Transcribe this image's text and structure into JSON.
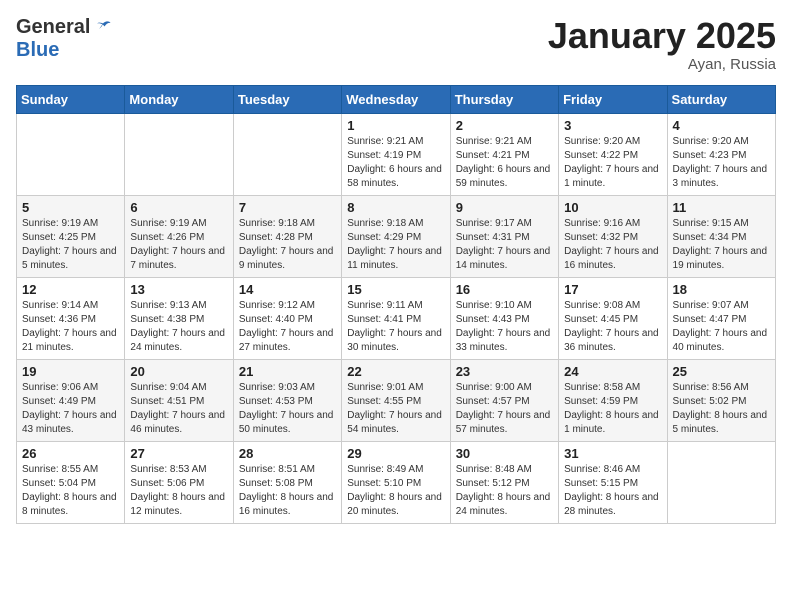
{
  "logo": {
    "general": "General",
    "blue": "Blue"
  },
  "title": {
    "month": "January 2025",
    "location": "Ayan, Russia"
  },
  "weekdays": [
    "Sunday",
    "Monday",
    "Tuesday",
    "Wednesday",
    "Thursday",
    "Friday",
    "Saturday"
  ],
  "weeks": [
    [
      {
        "day": "",
        "sunrise": "",
        "sunset": "",
        "daylight": ""
      },
      {
        "day": "",
        "sunrise": "",
        "sunset": "",
        "daylight": ""
      },
      {
        "day": "",
        "sunrise": "",
        "sunset": "",
        "daylight": ""
      },
      {
        "day": "1",
        "sunrise": "Sunrise: 9:21 AM",
        "sunset": "Sunset: 4:19 PM",
        "daylight": "Daylight: 6 hours and 58 minutes."
      },
      {
        "day": "2",
        "sunrise": "Sunrise: 9:21 AM",
        "sunset": "Sunset: 4:21 PM",
        "daylight": "Daylight: 6 hours and 59 minutes."
      },
      {
        "day": "3",
        "sunrise": "Sunrise: 9:20 AM",
        "sunset": "Sunset: 4:22 PM",
        "daylight": "Daylight: 7 hours and 1 minute."
      },
      {
        "day": "4",
        "sunrise": "Sunrise: 9:20 AM",
        "sunset": "Sunset: 4:23 PM",
        "daylight": "Daylight: 7 hours and 3 minutes."
      }
    ],
    [
      {
        "day": "5",
        "sunrise": "Sunrise: 9:19 AM",
        "sunset": "Sunset: 4:25 PM",
        "daylight": "Daylight: 7 hours and 5 minutes."
      },
      {
        "day": "6",
        "sunrise": "Sunrise: 9:19 AM",
        "sunset": "Sunset: 4:26 PM",
        "daylight": "Daylight: 7 hours and 7 minutes."
      },
      {
        "day": "7",
        "sunrise": "Sunrise: 9:18 AM",
        "sunset": "Sunset: 4:28 PM",
        "daylight": "Daylight: 7 hours and 9 minutes."
      },
      {
        "day": "8",
        "sunrise": "Sunrise: 9:18 AM",
        "sunset": "Sunset: 4:29 PM",
        "daylight": "Daylight: 7 hours and 11 minutes."
      },
      {
        "day": "9",
        "sunrise": "Sunrise: 9:17 AM",
        "sunset": "Sunset: 4:31 PM",
        "daylight": "Daylight: 7 hours and 14 minutes."
      },
      {
        "day": "10",
        "sunrise": "Sunrise: 9:16 AM",
        "sunset": "Sunset: 4:32 PM",
        "daylight": "Daylight: 7 hours and 16 minutes."
      },
      {
        "day": "11",
        "sunrise": "Sunrise: 9:15 AM",
        "sunset": "Sunset: 4:34 PM",
        "daylight": "Daylight: 7 hours and 19 minutes."
      }
    ],
    [
      {
        "day": "12",
        "sunrise": "Sunrise: 9:14 AM",
        "sunset": "Sunset: 4:36 PM",
        "daylight": "Daylight: 7 hours and 21 minutes."
      },
      {
        "day": "13",
        "sunrise": "Sunrise: 9:13 AM",
        "sunset": "Sunset: 4:38 PM",
        "daylight": "Daylight: 7 hours and 24 minutes."
      },
      {
        "day": "14",
        "sunrise": "Sunrise: 9:12 AM",
        "sunset": "Sunset: 4:40 PM",
        "daylight": "Daylight: 7 hours and 27 minutes."
      },
      {
        "day": "15",
        "sunrise": "Sunrise: 9:11 AM",
        "sunset": "Sunset: 4:41 PM",
        "daylight": "Daylight: 7 hours and 30 minutes."
      },
      {
        "day": "16",
        "sunrise": "Sunrise: 9:10 AM",
        "sunset": "Sunset: 4:43 PM",
        "daylight": "Daylight: 7 hours and 33 minutes."
      },
      {
        "day": "17",
        "sunrise": "Sunrise: 9:08 AM",
        "sunset": "Sunset: 4:45 PM",
        "daylight": "Daylight: 7 hours and 36 minutes."
      },
      {
        "day": "18",
        "sunrise": "Sunrise: 9:07 AM",
        "sunset": "Sunset: 4:47 PM",
        "daylight": "Daylight: 7 hours and 40 minutes."
      }
    ],
    [
      {
        "day": "19",
        "sunrise": "Sunrise: 9:06 AM",
        "sunset": "Sunset: 4:49 PM",
        "daylight": "Daylight: 7 hours and 43 minutes."
      },
      {
        "day": "20",
        "sunrise": "Sunrise: 9:04 AM",
        "sunset": "Sunset: 4:51 PM",
        "daylight": "Daylight: 7 hours and 46 minutes."
      },
      {
        "day": "21",
        "sunrise": "Sunrise: 9:03 AM",
        "sunset": "Sunset: 4:53 PM",
        "daylight": "Daylight: 7 hours and 50 minutes."
      },
      {
        "day": "22",
        "sunrise": "Sunrise: 9:01 AM",
        "sunset": "Sunset: 4:55 PM",
        "daylight": "Daylight: 7 hours and 54 minutes."
      },
      {
        "day": "23",
        "sunrise": "Sunrise: 9:00 AM",
        "sunset": "Sunset: 4:57 PM",
        "daylight": "Daylight: 7 hours and 57 minutes."
      },
      {
        "day": "24",
        "sunrise": "Sunrise: 8:58 AM",
        "sunset": "Sunset: 4:59 PM",
        "daylight": "Daylight: 8 hours and 1 minute."
      },
      {
        "day": "25",
        "sunrise": "Sunrise: 8:56 AM",
        "sunset": "Sunset: 5:02 PM",
        "daylight": "Daylight: 8 hours and 5 minutes."
      }
    ],
    [
      {
        "day": "26",
        "sunrise": "Sunrise: 8:55 AM",
        "sunset": "Sunset: 5:04 PM",
        "daylight": "Daylight: 8 hours and 8 minutes."
      },
      {
        "day": "27",
        "sunrise": "Sunrise: 8:53 AM",
        "sunset": "Sunset: 5:06 PM",
        "daylight": "Daylight: 8 hours and 12 minutes."
      },
      {
        "day": "28",
        "sunrise": "Sunrise: 8:51 AM",
        "sunset": "Sunset: 5:08 PM",
        "daylight": "Daylight: 8 hours and 16 minutes."
      },
      {
        "day": "29",
        "sunrise": "Sunrise: 8:49 AM",
        "sunset": "Sunset: 5:10 PM",
        "daylight": "Daylight: 8 hours and 20 minutes."
      },
      {
        "day": "30",
        "sunrise": "Sunrise: 8:48 AM",
        "sunset": "Sunset: 5:12 PM",
        "daylight": "Daylight: 8 hours and 24 minutes."
      },
      {
        "day": "31",
        "sunrise": "Sunrise: 8:46 AM",
        "sunset": "Sunset: 5:15 PM",
        "daylight": "Daylight: 8 hours and 28 minutes."
      },
      {
        "day": "",
        "sunrise": "",
        "sunset": "",
        "daylight": ""
      }
    ]
  ]
}
